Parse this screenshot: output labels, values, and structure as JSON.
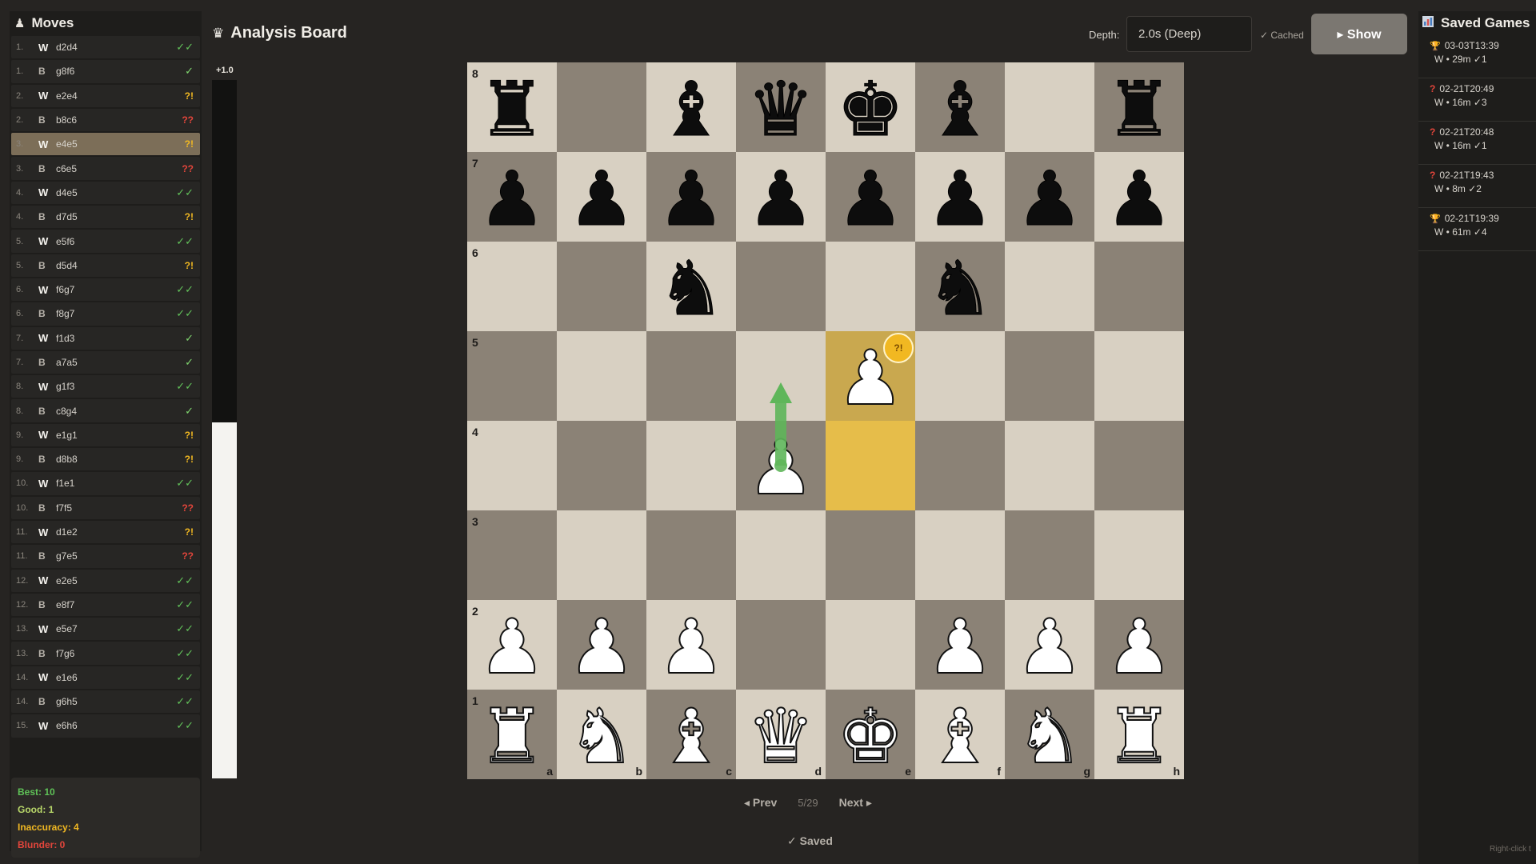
{
  "moves_panel": {
    "title": "Moves",
    "icon": "pawn-icon",
    "moves": [
      {
        "num": "1.",
        "side": "W",
        "move": "d2d4",
        "mark": "✓✓",
        "quality": "best"
      },
      {
        "num": "1.",
        "side": "B",
        "move": "g8f6",
        "mark": "✓",
        "quality": "good"
      },
      {
        "num": "2.",
        "side": "W",
        "move": "e2e4",
        "mark": "?!",
        "quality": "inaccuracy"
      },
      {
        "num": "2.",
        "side": "B",
        "move": "b8c6",
        "mark": "??",
        "quality": "blunder"
      },
      {
        "num": "3.",
        "side": "W",
        "move": "e4e5",
        "mark": "?!",
        "quality": "inaccuracy",
        "active": true
      },
      {
        "num": "3.",
        "side": "B",
        "move": "c6e5",
        "mark": "??",
        "quality": "blunder"
      },
      {
        "num": "4.",
        "side": "W",
        "move": "d4e5",
        "mark": "✓✓",
        "quality": "best"
      },
      {
        "num": "4.",
        "side": "B",
        "move": "d7d5",
        "mark": "?!",
        "quality": "inaccuracy"
      },
      {
        "num": "5.",
        "side": "W",
        "move": "e5f6",
        "mark": "✓✓",
        "quality": "best"
      },
      {
        "num": "5.",
        "side": "B",
        "move": "d5d4",
        "mark": "?!",
        "quality": "inaccuracy"
      },
      {
        "num": "6.",
        "side": "W",
        "move": "f6g7",
        "mark": "✓✓",
        "quality": "best"
      },
      {
        "num": "6.",
        "side": "B",
        "move": "f8g7",
        "mark": "✓✓",
        "quality": "best"
      },
      {
        "num": "7.",
        "side": "W",
        "move": "f1d3",
        "mark": "✓",
        "quality": "good"
      },
      {
        "num": "7.",
        "side": "B",
        "move": "a7a5",
        "mark": "✓",
        "quality": "good"
      },
      {
        "num": "8.",
        "side": "W",
        "move": "g1f3",
        "mark": "✓✓",
        "quality": "best"
      },
      {
        "num": "8.",
        "side": "B",
        "move": "c8g4",
        "mark": "✓",
        "quality": "good"
      },
      {
        "num": "9.",
        "side": "W",
        "move": "e1g1",
        "mark": "?!",
        "quality": "inaccuracy"
      },
      {
        "num": "9.",
        "side": "B",
        "move": "d8b8",
        "mark": "?!",
        "quality": "inaccuracy"
      },
      {
        "num": "10.",
        "side": "W",
        "move": "f1e1",
        "mark": "✓✓",
        "quality": "best"
      },
      {
        "num": "10.",
        "side": "B",
        "move": "f7f5",
        "mark": "??",
        "quality": "blunder"
      },
      {
        "num": "11.",
        "side": "W",
        "move": "d1e2",
        "mark": "?!",
        "quality": "inaccuracy"
      },
      {
        "num": "11.",
        "side": "B",
        "move": "g7e5",
        "mark": "??",
        "quality": "blunder"
      },
      {
        "num": "12.",
        "side": "W",
        "move": "e2e5",
        "mark": "✓✓",
        "quality": "best"
      },
      {
        "num": "12.",
        "side": "B",
        "move": "e8f7",
        "mark": "✓✓",
        "quality": "best"
      },
      {
        "num": "13.",
        "side": "W",
        "move": "e5e7",
        "mark": "✓✓",
        "quality": "best"
      },
      {
        "num": "13.",
        "side": "B",
        "move": "f7g6",
        "mark": "✓✓",
        "quality": "best"
      },
      {
        "num": "14.",
        "side": "W",
        "move": "e1e6",
        "mark": "✓✓",
        "quality": "best"
      },
      {
        "num": "14.",
        "side": "B",
        "move": "g6h5",
        "mark": "✓✓",
        "quality": "best"
      },
      {
        "num": "15.",
        "side": "W",
        "move": "e6h6",
        "mark": "✓✓",
        "quality": "best"
      }
    ],
    "summary": {
      "best": "Best: 10",
      "good": "Good: 1",
      "inaccuracy": "Inaccuracy: 4",
      "blunder": "Blunder: 0"
    }
  },
  "header": {
    "title": "Analysis Board",
    "title_icon": "crown-icon",
    "depth_label": "Depth:",
    "depth_value": "2.0s (Deep)",
    "cached_label": "✓ Cached",
    "show_button": "▸ Show"
  },
  "eval": {
    "label": "+1.0",
    "white_fraction": 0.51
  },
  "board": {
    "ranks": [
      "8",
      "7",
      "6",
      "5",
      "4",
      "3",
      "2",
      "1"
    ],
    "files": [
      "a",
      "b",
      "c",
      "d",
      "e",
      "f",
      "g",
      "h"
    ],
    "rows": [
      [
        "r",
        "",
        "b",
        "q",
        "k",
        "b",
        "",
        "r"
      ],
      [
        "p",
        "p",
        "p",
        "p",
        "p",
        "p",
        "p",
        "p"
      ],
      [
        "",
        "",
        "n",
        "",
        "",
        "n",
        "",
        ""
      ],
      [
        "",
        "",
        "",
        "",
        "P",
        "",
        "",
        ""
      ],
      [
        "",
        "",
        "",
        "P",
        "",
        "",
        "",
        ""
      ],
      [
        "",
        "",
        "",
        "",
        "",
        "",
        "",
        ""
      ],
      [
        "P",
        "P",
        "P",
        "",
        "",
        "P",
        "P",
        "P"
      ],
      [
        "R",
        "N",
        "B",
        "Q",
        "K",
        "B",
        "N",
        "R"
      ]
    ],
    "highlight_from": "e4",
    "highlight_to": "e5",
    "move_badge": "?!",
    "arrow": {
      "from": "d4",
      "to": "d5",
      "color": "#5fb65a"
    }
  },
  "nav": {
    "prev": "◂ Prev",
    "page": "5/29",
    "next": "Next ▸"
  },
  "status": {
    "saved": "✓ Saved"
  },
  "saved_games": {
    "title": "Saved Games",
    "icon": "bar-chart-icon",
    "items": [
      {
        "icon": "trophy-icon",
        "date": "03-03T13:39",
        "detail": "W • 29m ✓1"
      },
      {
        "icon": "question-icon",
        "date": "02-21T20:49",
        "detail": "W • 16m ✓3"
      },
      {
        "icon": "question-icon",
        "date": "02-21T20:48",
        "detail": "W • 16m ✓1"
      },
      {
        "icon": "question-icon",
        "date": "02-21T19:43",
        "detail": "W • 8m ✓2"
      },
      {
        "icon": "trophy-icon",
        "date": "02-21T19:39",
        "detail": "W • 61m ✓4"
      }
    ],
    "hint": "Right-click t"
  }
}
